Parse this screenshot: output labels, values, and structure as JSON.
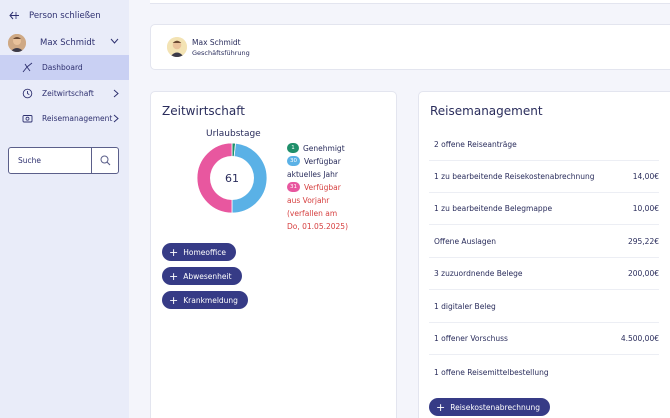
{
  "sidebar": {
    "close_label": "Person schließen",
    "user_name": "Max Schmidt",
    "items": [
      {
        "label": "Dashboard"
      },
      {
        "label": "Zeitwirtschaft"
      },
      {
        "label": "Reisemanagement"
      }
    ],
    "search_placeholder": "Suche"
  },
  "profile": {
    "name": "Max Schmidt",
    "role": "Geschäftsführung"
  },
  "zeitwirtschaft": {
    "title": "Zeitwirtschaft",
    "donut_title": "Urlaubstage",
    "donut_total": "61",
    "legend": [
      {
        "badge": "1",
        "text": "Genehmigt",
        "color": "#1f8f6a"
      },
      {
        "badge": "30",
        "text": "Verfügbar",
        "text2": "aktuelles Jahr",
        "color": "#5ab1e6"
      },
      {
        "badge": "31",
        "text": "Verfügbar",
        "text2": "aus Vorjahr",
        "text3": "(verfallen am",
        "text4": "Do, 01.05.2025)",
        "color": "#e8579f"
      }
    ],
    "buttons": [
      "Homeoffice",
      "Abwesenheit",
      "Krankmeldung"
    ]
  },
  "chart_data": {
    "type": "pie",
    "title": "Urlaubstage",
    "categories": [
      "Genehmigt",
      "Verfügbar aktuelles Jahr",
      "Verfügbar aus Vorjahr"
    ],
    "values": [
      1,
      30,
      31
    ],
    "colors": [
      "#1f8f6a",
      "#5ab1e6",
      "#e8579f"
    ],
    "center_label": "61"
  },
  "reisemanagement": {
    "title": "Reisemanagement",
    "rows": [
      {
        "label": "2 offene Reiseanträge",
        "value": ""
      },
      {
        "label": "1 zu bearbeitende Reisekostenabrechnung",
        "value": "14,00€"
      },
      {
        "label": "1 zu bearbeitende Belegmappe",
        "value": "10,00€"
      },
      {
        "label": "Offene Auslagen",
        "value": "295,22€"
      },
      {
        "label": "3 zuzuordnende Belege",
        "value": "200,00€"
      },
      {
        "label": "1 digitaler Beleg",
        "value": ""
      },
      {
        "label": "1 offener Vorschuss",
        "value": "4.500,00€"
      },
      {
        "label": "1 offene Reisemittelbestellung",
        "value": ""
      }
    ],
    "button": "Reisekostenabrechnung"
  }
}
